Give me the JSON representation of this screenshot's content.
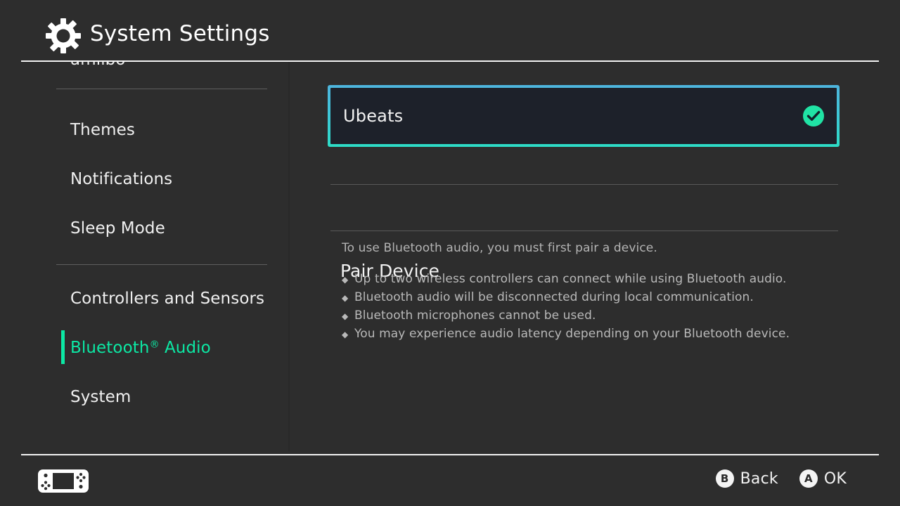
{
  "header": {
    "title": "System Settings",
    "icon": "gear-icon"
  },
  "sidebar": {
    "items": [
      {
        "label": "amiibo",
        "selected": false,
        "clipped": true
      },
      {
        "label": "Themes",
        "selected": false
      },
      {
        "label": "Notifications",
        "selected": false
      },
      {
        "label": "Sleep Mode",
        "selected": false
      },
      {
        "label": "Controllers and Sensors",
        "selected": false
      },
      {
        "label_prefix": "Bluetooth",
        "label_sup": "®",
        "label_suffix": " Audio",
        "label": "Bluetooth® Audio",
        "selected": true
      },
      {
        "label": "System",
        "selected": false
      }
    ],
    "accent_color": "#0ce8a4"
  },
  "content": {
    "device": {
      "name": "Ubeats",
      "connected": true,
      "check_icon": "check-circle-icon",
      "check_color": "#20e3a5",
      "border_color_top": "#4eb4dd",
      "border_color_bottom": "#2ddcc6"
    },
    "pair_section": {
      "heading": "Pair Device",
      "description": "To use Bluetooth audio, you must first pair a device.",
      "bullet_mark": "◆",
      "bullets": [
        "Up to two wireless controllers can connect while using Bluetooth audio.",
        "Bluetooth audio will be disconnected during local communication.",
        "Bluetooth microphones cannot be used.",
        "You may experience audio latency depending on your Bluetooth device."
      ]
    }
  },
  "footer": {
    "console_icon": "switch-console-icon",
    "actions": [
      {
        "glyph": "B",
        "label": "Back"
      },
      {
        "glyph": "A",
        "label": "OK"
      }
    ]
  }
}
